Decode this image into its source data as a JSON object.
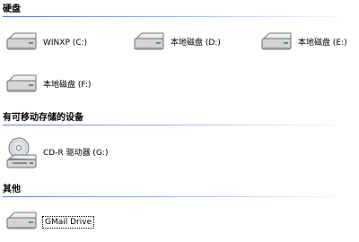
{
  "sections": [
    {
      "title": "硬盘",
      "items": [
        {
          "label": "WINXP (C:)",
          "icon": "hard-drive-icon"
        },
        {
          "label": "本地磁盘 (D:)",
          "icon": "hard-drive-icon"
        },
        {
          "label": "本地磁盘 (E:)",
          "icon": "hard-drive-icon"
        },
        {
          "label": "本地磁盘 (F:)",
          "icon": "hard-drive-icon"
        }
      ]
    },
    {
      "title": "有可移动存储的设备",
      "items": [
        {
          "label": "CD-R 驱动器 (G:)",
          "icon": "cd-drive-icon"
        }
      ]
    },
    {
      "title": "其他",
      "items": [
        {
          "label": "GMail Drive",
          "icon": "hard-drive-icon",
          "focused": true
        }
      ]
    }
  ],
  "colors": {
    "section_rule": "#5b7ec9",
    "drive_body": "#d4d4d4",
    "drive_dark": "#6e6e6e"
  }
}
